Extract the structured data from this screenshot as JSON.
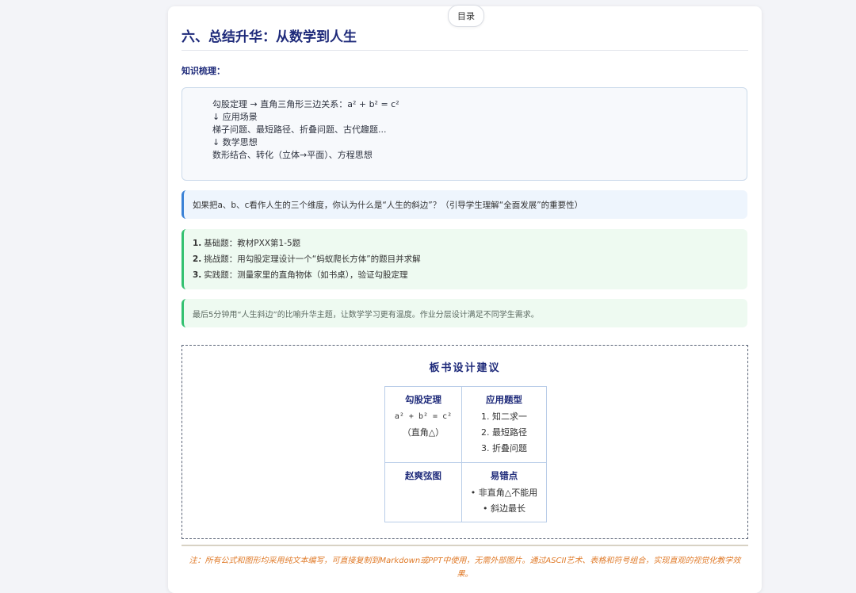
{
  "toc_button": "目录",
  "section_title": "六、总结升华：从数学到人生",
  "knowledge_label": "知识梳理：",
  "mindmap": [
    "勾股定理 → 直角三角形三边关系：a² + b² = c²",
    "↓ 应用场景",
    "梯子问题、最短路径、折叠问题、古代趣题...",
    "↓ 数学思想",
    "数形结合、转化（立体→平面）、方程思想"
  ],
  "reflection": "如果把a、b、c看作人生的三个维度，你认为什么是“人生的斜边”？（引导学生理解“全面发展”的重要性）",
  "homework": [
    {
      "num": "1.",
      "text": "基础题：教材PXX第1-5题"
    },
    {
      "num": "2.",
      "text": "挑战题：用勾股定理设计一个“蚂蚁爬长方体”的题目并求解"
    },
    {
      "num": "3.",
      "text": "实践题：测量家里的直角物体（如书桌），验证勾股定理"
    }
  ],
  "teacher_note": "最后5分钟用“人生斜边”的比喻升华主题，让数学学习更有温度。作业分层设计满足不同学生需求。",
  "board": {
    "title": "板书设计建议",
    "cells": {
      "top_left": {
        "head": "勾股定理",
        "lines": [
          "a² + b² = c²",
          "（直角△）"
        ]
      },
      "top_right": {
        "head": "应用题型",
        "lines": [
          "1. 知二求一",
          "2. 最短路径",
          "3. 折叠问题"
        ]
      },
      "bottom_left": {
        "head": "赵爽弦图",
        "lines": []
      },
      "bottom_right": {
        "head": "易错点",
        "lines": [
          "• 非直角△不能用",
          "• 斜边最长"
        ]
      }
    }
  },
  "footer_note": "注：所有公式和图形均采用纯文本编写，可直接复制到Markdown或PPT中使用，无需外部图片。通过ASCII艺术、表格和符号组合，实现直观的视觉化教学效果。"
}
